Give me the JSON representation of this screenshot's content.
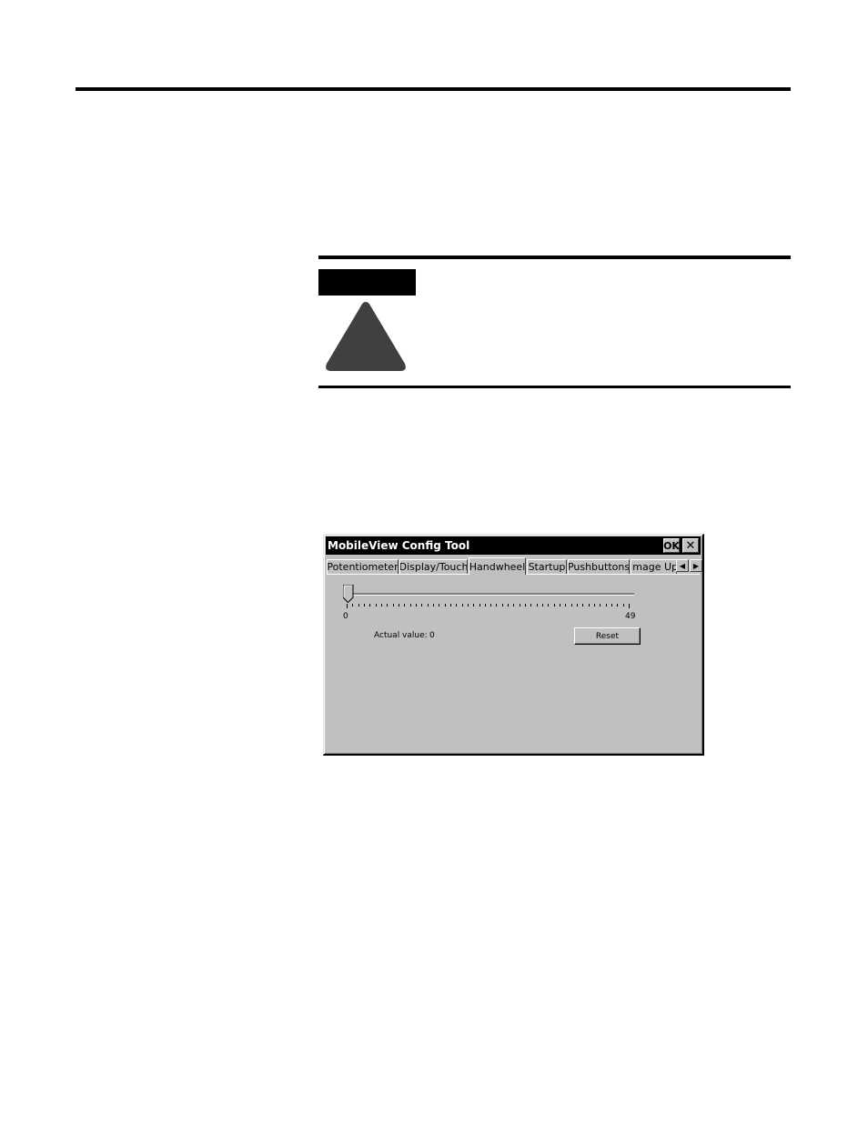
{
  "window": {
    "title": "MobileView Config Tool",
    "ok_label": "OK",
    "close_label": "✕"
  },
  "tabs": [
    {
      "label": "Potentiometer",
      "active": false
    },
    {
      "label": "Display/Touch",
      "active": false
    },
    {
      "label": "Handwheel",
      "active": true
    },
    {
      "label": "Startup",
      "active": false
    },
    {
      "label": "Pushbuttons",
      "active": false
    },
    {
      "label": "Image Up",
      "active": false
    }
  ],
  "tab_scroll": {
    "left": "◀",
    "right": "▶"
  },
  "handwheel": {
    "slider_min_label": "0",
    "slider_max_label": "49",
    "slider_value": 0,
    "slider_max": 49,
    "actual_value_label": "Actual value:",
    "actual_value": "0",
    "reset_label": "Reset"
  },
  "colors": {
    "window_face": "#c0c0c0",
    "titlebar": "#000000",
    "warning_triangle": "#404040"
  }
}
